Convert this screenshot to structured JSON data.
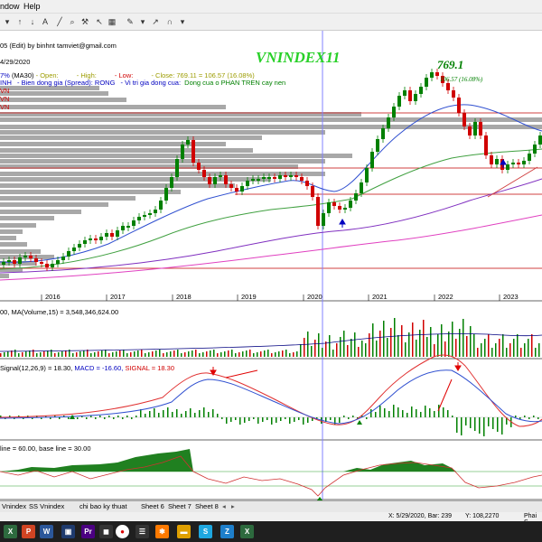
{
  "menu": {
    "window": "ndow",
    "help": "Help"
  },
  "header": {
    "file_line": "05 (Edit) by binhnt tamviet@gmail.com",
    "date_line": "4/29/2020",
    "ohlc_pct": "7%",
    "ma_label": "(MA30)",
    "open_label": "- Open:",
    "high_label": "- High:",
    "low_label": "- Low:",
    "close_label": "- Close: 769.11 = 106.57 (16.08%)",
    "spread_prefix": "INH",
    "spread_text": "- Bien dong gia (Spread): RONG",
    "position_text": "- Vi tri gia dong cua:",
    "position_value": "Dong cua o PHAN TREN cay nen",
    "side_labels": [
      "VN",
      "VN",
      "VN"
    ]
  },
  "chart_title": "VNINDEX11",
  "callout": {
    "price": "769.1",
    "change": "106.57 (16.08%)"
  },
  "chart_data": [
    {
      "type": "candlestick",
      "title": "VNINDEX11",
      "x_tick_labels": [
        "2016",
        "2017",
        "2018",
        "2019",
        "2020",
        "2021",
        "2022",
        "2023"
      ],
      "last_close": 769.11,
      "change": 106.57,
      "change_pct": 16.08,
      "indicators": [
        "MA30",
        "Volume profile"
      ]
    },
    {
      "type": "bar",
      "title": "Volume",
      "label": "00, MA(Volume,15) = 3,548,346,624.00"
    },
    {
      "type": "line",
      "title": "MACD",
      "label_prefix": "Signal(12,26,9) = 18.30,",
      "label_macd": "MACD = -16.60,",
      "label_signal": "SIGNAL = 18.30",
      "series": [
        {
          "name": "MACD"
        },
        {
          "name": "SIGNAL"
        }
      ]
    },
    {
      "type": "area",
      "title": "RSI",
      "label": "line = 60.00, base line = 30.00",
      "top_line": 60.0,
      "base_line": 30.0
    }
  ],
  "sheets": [
    "Vnindex",
    "SS Vnindex",
    "chi bao ky thuat",
    "Sheet 6",
    "Sheet 7",
    "Sheet 8"
  ],
  "status": {
    "cursor": "X: 5/29/2020, Bar: 239",
    "y_value": "Y: 108,2270",
    "right": "Phai S"
  },
  "colors": {
    "up": "#008000",
    "down": "#d00000",
    "ma_blue": "#3050d0",
    "ma_green": "#40a040",
    "ma_purple": "#8030c0",
    "ma_pink": "#e040c0",
    "grid_red": "#d04040"
  }
}
